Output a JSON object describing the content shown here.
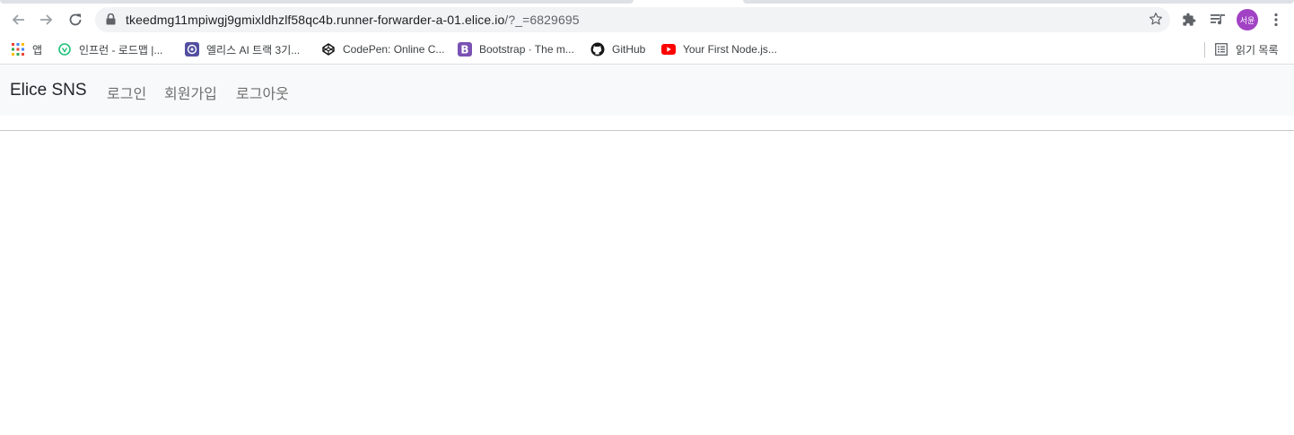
{
  "browser": {
    "url_main": "tkeedmg11mpiwgj9gmixldhzlf58qc4b.runner-forwarder-a-01.elice.io",
    "url_rest": "/?_=6829695",
    "profile_initials": "서윤"
  },
  "bookmarks": [
    {
      "label": "앱",
      "icon": "apps-grid-icon"
    },
    {
      "label": "인프런 - 로드맵 |...",
      "icon": "inflearn-icon"
    },
    {
      "label": "엘리스 AI 트랙 3기...",
      "icon": "elice-icon"
    },
    {
      "label": "CodePen: Online C...",
      "icon": "codepen-icon"
    },
    {
      "label": "Bootstrap · The m...",
      "icon": "bootstrap-icon"
    },
    {
      "label": "GitHub",
      "icon": "github-icon"
    },
    {
      "label": "Your First Node.js...",
      "icon": "youtube-icon"
    }
  ],
  "reading_list": {
    "label": "읽기 목록"
  },
  "navbar": {
    "brand": "Elice SNS",
    "links": [
      {
        "label": "로그인"
      },
      {
        "label": "회원가입"
      },
      {
        "label": "로그아웃"
      }
    ]
  },
  "colors": {
    "navbar_bg": "#f8f9fa",
    "brand_text": "#212529",
    "link_text": "#6f6f6f",
    "avatar_bg": "#a142c4",
    "bootstrap_purple": "#7952b3",
    "youtube_red": "#ff0000"
  }
}
